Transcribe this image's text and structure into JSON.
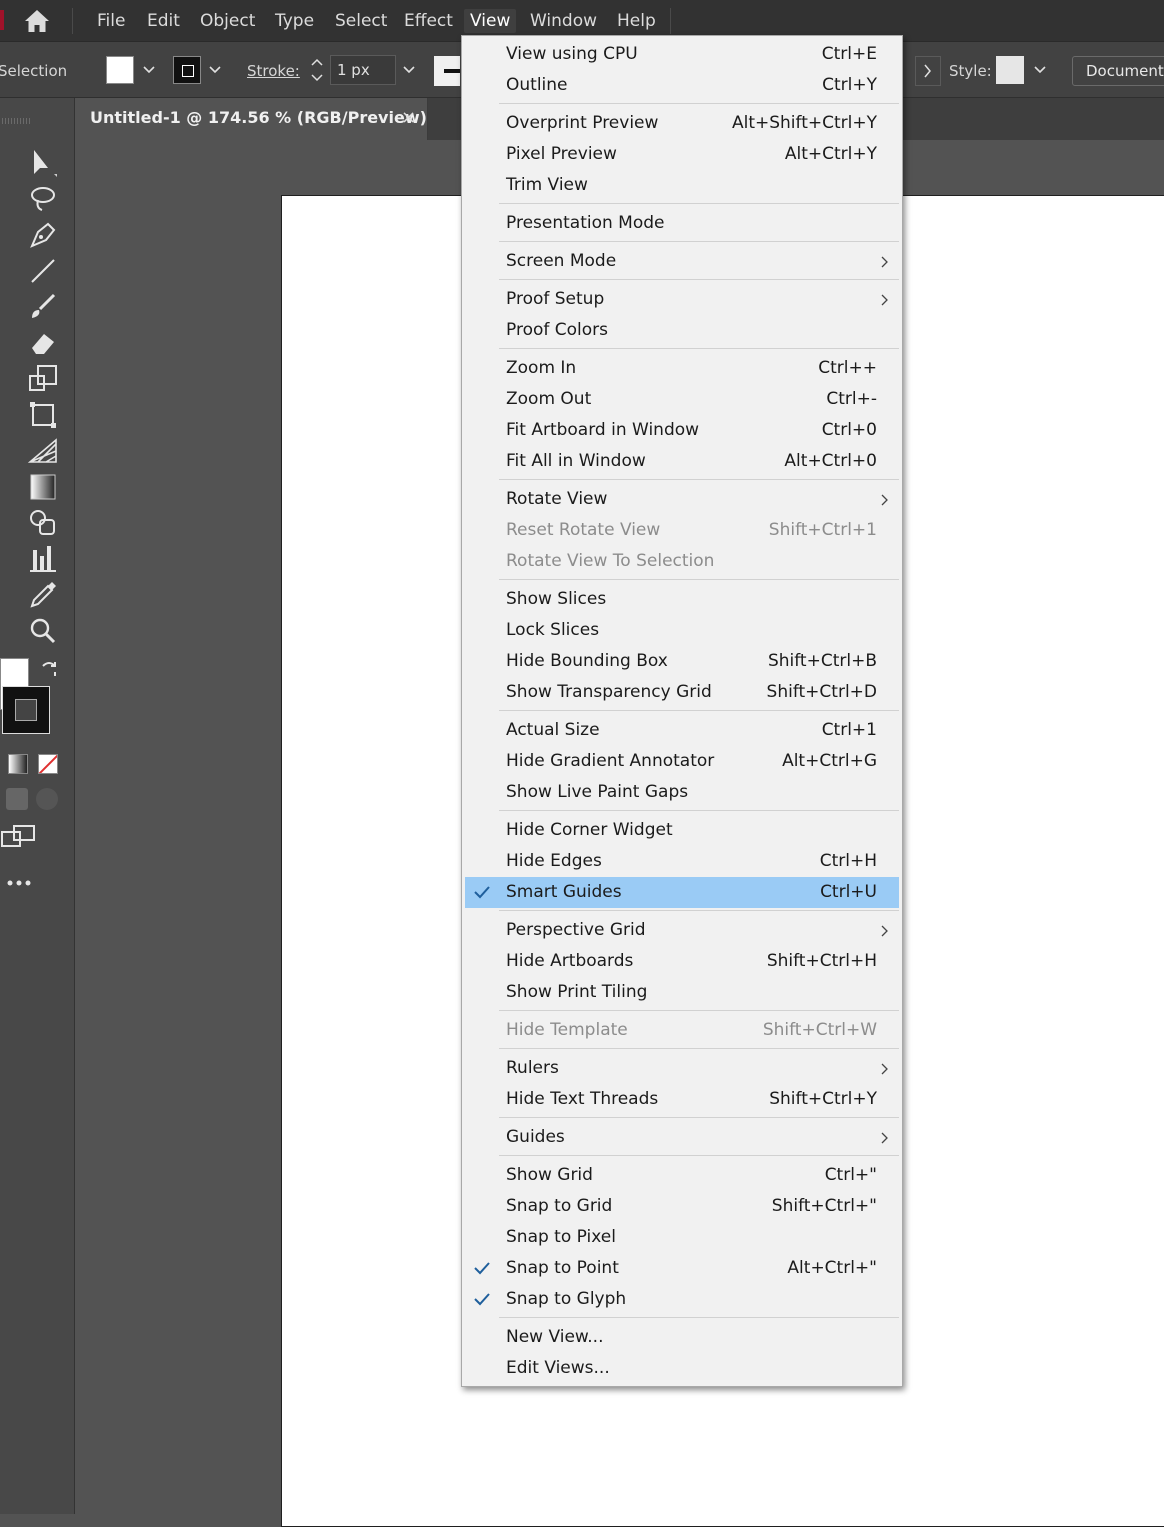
{
  "menubar": {
    "items": [
      "File",
      "Edit",
      "Object",
      "Type",
      "Select",
      "Effect",
      "View",
      "Window",
      "Help"
    ],
    "active": "View"
  },
  "controlbar": {
    "selection_label": "Selection",
    "stroke_label": "Stroke:",
    "stroke_value": "1 px",
    "style_label": "Style:",
    "document_button": "Document S"
  },
  "tab": {
    "title": "Untitled-1 @ 174.56 % (RGB/Preview)",
    "close": "×"
  },
  "view_menu": {
    "items": [
      {
        "label": "View using CPU",
        "shortcut": "Ctrl+E"
      },
      {
        "label": "Outline",
        "shortcut": "Ctrl+Y"
      },
      {
        "label": "Overprint Preview",
        "shortcut": "Alt+Shift+Ctrl+Y"
      },
      {
        "label": "Pixel Preview",
        "shortcut": "Alt+Ctrl+Y"
      },
      {
        "label": "Trim View",
        "shortcut": ""
      },
      {
        "label": "Presentation Mode",
        "shortcut": ""
      },
      {
        "label": "Screen Mode",
        "shortcut": "",
        "submenu": true
      },
      {
        "label": "Proof Setup",
        "shortcut": "",
        "submenu": true
      },
      {
        "label": "Proof Colors",
        "shortcut": ""
      },
      {
        "label": "Zoom In",
        "shortcut": "Ctrl++"
      },
      {
        "label": "Zoom Out",
        "shortcut": "Ctrl+-"
      },
      {
        "label": "Fit Artboard in Window",
        "shortcut": "Ctrl+0"
      },
      {
        "label": "Fit All in Window",
        "shortcut": "Alt+Ctrl+0"
      },
      {
        "label": "Rotate View",
        "shortcut": "",
        "submenu": true
      },
      {
        "label": "Reset Rotate View",
        "shortcut": "Shift+Ctrl+1",
        "disabled": true
      },
      {
        "label": "Rotate View To Selection",
        "shortcut": "",
        "disabled": true
      },
      {
        "label": "Show Slices",
        "shortcut": ""
      },
      {
        "label": "Lock Slices",
        "shortcut": ""
      },
      {
        "label": "Hide Bounding Box",
        "shortcut": "Shift+Ctrl+B"
      },
      {
        "label": "Show Transparency Grid",
        "shortcut": "Shift+Ctrl+D"
      },
      {
        "label": "Actual Size",
        "shortcut": "Ctrl+1"
      },
      {
        "label": "Hide Gradient Annotator",
        "shortcut": "Alt+Ctrl+G"
      },
      {
        "label": "Show Live Paint Gaps",
        "shortcut": ""
      },
      {
        "label": "Hide Corner Widget",
        "shortcut": ""
      },
      {
        "label": "Hide Edges",
        "shortcut": "Ctrl+H"
      },
      {
        "label": "Smart Guides",
        "shortcut": "Ctrl+U",
        "checked": true,
        "highlighted": true
      },
      {
        "label": "Perspective Grid",
        "shortcut": "",
        "submenu": true
      },
      {
        "label": "Hide Artboards",
        "shortcut": "Shift+Ctrl+H"
      },
      {
        "label": "Show Print Tiling",
        "shortcut": ""
      },
      {
        "label": "Hide Template",
        "shortcut": "Shift+Ctrl+W",
        "disabled": true
      },
      {
        "label": "Rulers",
        "shortcut": "",
        "submenu": true
      },
      {
        "label": "Hide Text Threads",
        "shortcut": "Shift+Ctrl+Y"
      },
      {
        "label": "Guides",
        "shortcut": "",
        "submenu": true
      },
      {
        "label": "Show Grid",
        "shortcut": "Ctrl+\""
      },
      {
        "label": "Snap to Grid",
        "shortcut": "Shift+Ctrl+\""
      },
      {
        "label": "Snap to Pixel",
        "shortcut": ""
      },
      {
        "label": "Snap to Point",
        "shortcut": "Alt+Ctrl+\"",
        "checked": true
      },
      {
        "label": "Snap to Glyph",
        "shortcut": "",
        "checked": true
      },
      {
        "label": "New View...",
        "shortcut": ""
      },
      {
        "label": "Edit Views...",
        "shortcut": ""
      }
    ]
  },
  "colors": {
    "highlight": "#9acbf5",
    "checkmark": "#1f5f9c",
    "menu_bg": "#f1f1f1",
    "app_bg": "#535353",
    "brand": "#a0122a"
  }
}
